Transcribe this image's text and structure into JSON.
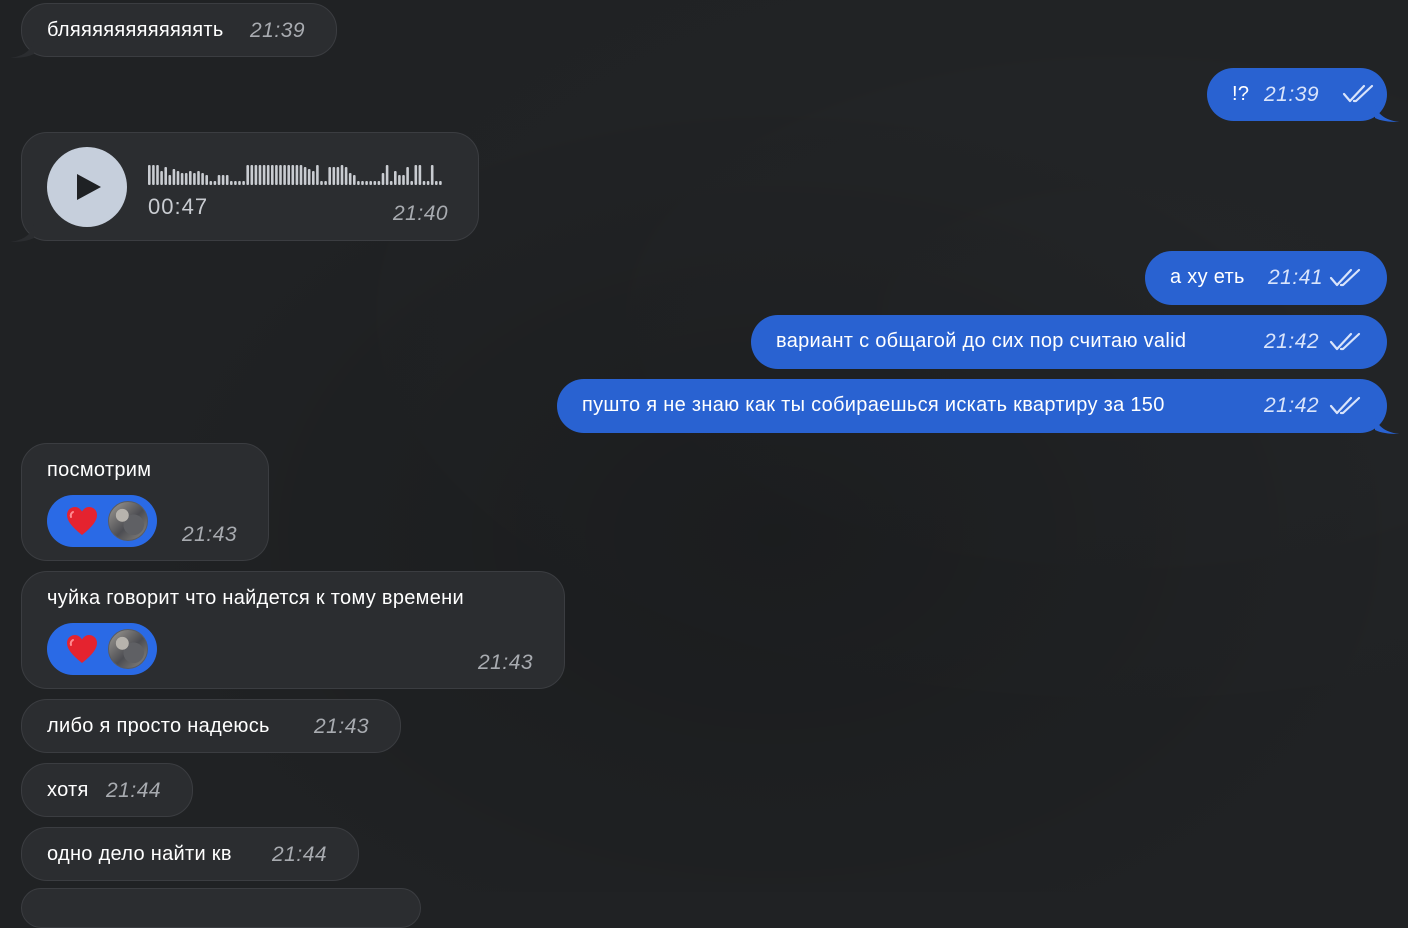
{
  "colors": {
    "background": "#202224",
    "incoming_bubble": "#2b2d30",
    "outgoing_bubble": "#2962d1",
    "reaction_pill": "#2a6ae6",
    "heart": "#e5232f"
  },
  "messages": [
    {
      "direction": "in",
      "text": "бляяяяяяяяяяяять",
      "time": "21:39"
    },
    {
      "direction": "out",
      "text": "!?",
      "time": "21:39",
      "status_icon": "double-check-icon"
    },
    {
      "direction": "in",
      "type": "voice",
      "duration": "00:47",
      "time": "21:40",
      "icon": "play-icon"
    },
    {
      "direction": "out",
      "text": "а ху еть",
      "time": "21:41",
      "status_icon": "double-check-icon"
    },
    {
      "direction": "out",
      "text": "вариант с общагой до сих пор считаю valid",
      "time": "21:42",
      "status_icon": "double-check-icon"
    },
    {
      "direction": "out",
      "text": "пушто я не знаю как ты собираешься искать квартиру за 150",
      "time": "21:42",
      "status_icon": "double-check-icon"
    },
    {
      "direction": "in",
      "text": "посмотрим",
      "time": "21:43",
      "reaction": "heart-icon"
    },
    {
      "direction": "in",
      "text": "чуйка говорит что найдется к тому времени",
      "time": "21:43",
      "reaction": "heart-icon"
    },
    {
      "direction": "in",
      "text": "либо я просто надеюсь",
      "time": "21:43"
    },
    {
      "direction": "in",
      "text": "хотя",
      "time": "21:44"
    },
    {
      "direction": "in",
      "text": "одно дело найти кв",
      "time": "21:44"
    }
  ]
}
